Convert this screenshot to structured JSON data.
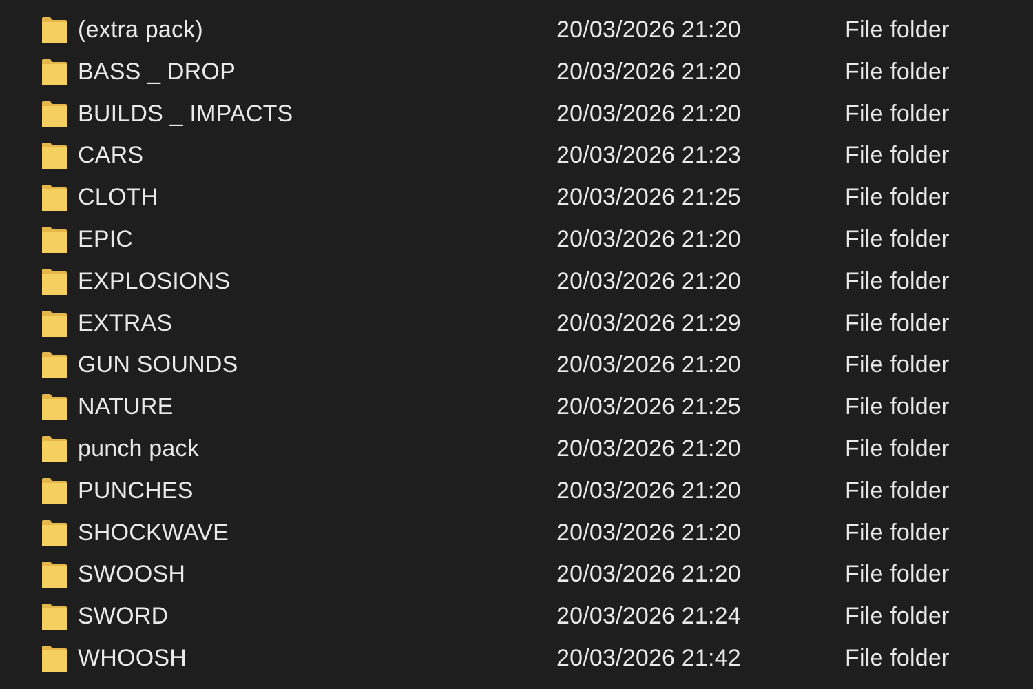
{
  "colors": {
    "background": "#1e1e1e",
    "text": "#e9e9e9",
    "folder_front": "#f6cf61",
    "folder_back": "#e5b74a"
  },
  "icon": "folder-icon",
  "rows": [
    {
      "name": "(extra pack)",
      "date_modified": "20/03/2026 21:20",
      "type": "File folder"
    },
    {
      "name": "BASS _ DROP",
      "date_modified": "20/03/2026 21:20",
      "type": "File folder"
    },
    {
      "name": "BUILDS _ IMPACTS",
      "date_modified": "20/03/2026 21:20",
      "type": "File folder"
    },
    {
      "name": "CARS",
      "date_modified": "20/03/2026 21:23",
      "type": "File folder"
    },
    {
      "name": "CLOTH",
      "date_modified": "20/03/2026 21:25",
      "type": "File folder"
    },
    {
      "name": "EPIC",
      "date_modified": "20/03/2026 21:20",
      "type": "File folder"
    },
    {
      "name": "EXPLOSIONS",
      "date_modified": "20/03/2026 21:20",
      "type": "File folder"
    },
    {
      "name": "EXTRAS",
      "date_modified": "20/03/2026 21:29",
      "type": "File folder"
    },
    {
      "name": "GUN SOUNDS",
      "date_modified": "20/03/2026 21:20",
      "type": "File folder"
    },
    {
      "name": "NATURE",
      "date_modified": "20/03/2026 21:25",
      "type": "File folder"
    },
    {
      "name": "punch pack",
      "date_modified": "20/03/2026 21:20",
      "type": "File folder"
    },
    {
      "name": "PUNCHES",
      "date_modified": "20/03/2026 21:20",
      "type": "File folder"
    },
    {
      "name": "SHOCKWAVE",
      "date_modified": "20/03/2026 21:20",
      "type": "File folder"
    },
    {
      "name": "SWOOSH",
      "date_modified": "20/03/2026 21:20",
      "type": "File folder"
    },
    {
      "name": "SWORD",
      "date_modified": "20/03/2026 21:24",
      "type": "File folder"
    },
    {
      "name": "WHOOSH",
      "date_modified": "20/03/2026 21:42",
      "type": "File folder"
    }
  ]
}
